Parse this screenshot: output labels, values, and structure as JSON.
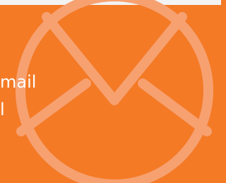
{
  "banner": {
    "lines": [
      "mail",
      "l"
    ],
    "icon": "envelope-icon",
    "colors": {
      "background": "#f47a26",
      "text": "#ffffff",
      "icon": "#f7a171",
      "edge": "#f3f3f3"
    }
  }
}
